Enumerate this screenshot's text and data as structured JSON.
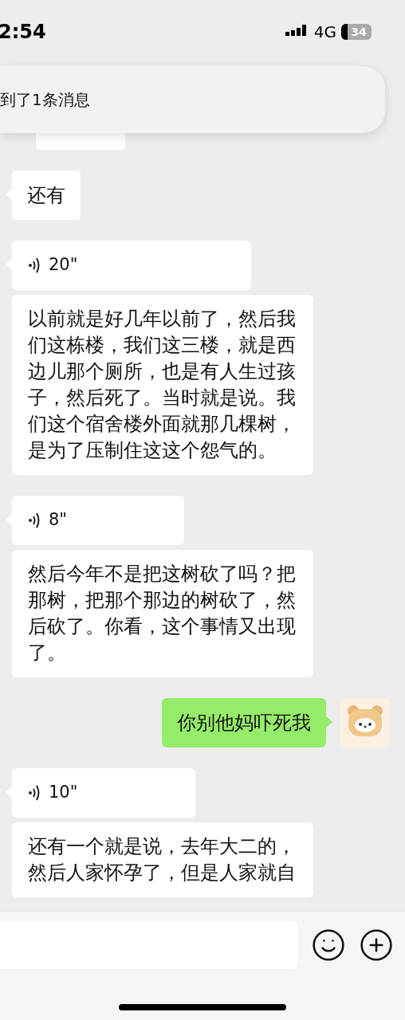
{
  "status_bar": {
    "time": "2:54",
    "network": "4G",
    "battery": "34"
  },
  "notification": {
    "text": "到了1条消息"
  },
  "messages": [
    {
      "kind": "received",
      "text": "还有"
    },
    {
      "kind": "voice",
      "duration": "20\"",
      "transcript": "以前就是好几年以前了，然后我们这栋楼，我们这三楼，就是西边儿那个厕所，也是有人生过孩子，然后死了。当时就是说。我们这个宿舍楼外面就那几棵树，是为了压制住这这个怨气的。"
    },
    {
      "kind": "voice",
      "duration": "8\"",
      "transcript": "然后今年不是把这树砍了吗？把那树，把那个那边的树砍了，然后砍了。你看，这个事情又出现了。"
    },
    {
      "kind": "sent",
      "text": "你别他妈吓死我"
    },
    {
      "kind": "voice",
      "duration": "10\"",
      "transcript": "还有一个就是说，去年大二的，然后人家怀孕了，但是人家就自"
    }
  ]
}
